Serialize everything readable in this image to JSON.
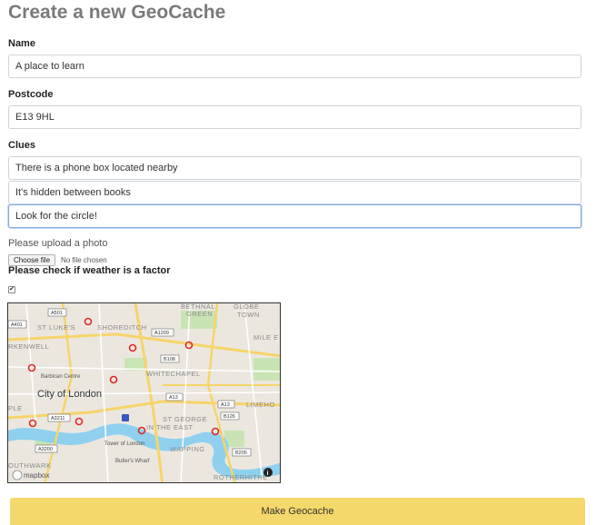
{
  "page": {
    "title": "Create a new GeoCache"
  },
  "form": {
    "name_label": "Name",
    "name_value": "A place to learn",
    "postcode_label": "Postcode",
    "postcode_value": "E13 9HL",
    "clues_label": "Clues",
    "clues": [
      "There is a phone box located nearby",
      "It's hidden between books",
      "Look for the circle!"
    ],
    "photo_label": "Please upload a photo",
    "file_button": "Choose file",
    "file_status": "No file chosen",
    "weather_label": "Please check if weather is a factor",
    "weather_checked": true,
    "submit_label": "Make Geocache"
  },
  "map": {
    "areas": [
      "BETHNAL",
      "GREEN",
      "GLOBE",
      "TOWN",
      "ST LUKE'S",
      "SHOREDITCH",
      "MILE E",
      "RKENWELL",
      "Barbican Centre",
      "WHITECHAPEL",
      "City of London",
      "LIMEHO",
      "PLE",
      "ST GEORGE",
      "IN THE EAST",
      "Tower of London",
      "WAPPING",
      "OUTHWARK",
      "Butler's Wharf",
      "ROTHERHITHE"
    ],
    "roads": [
      "A501",
      "A401",
      "A1209",
      "B108",
      "A13",
      "A3211",
      "B126",
      "A3200",
      "B205"
    ],
    "attribution": "mapbox",
    "info_icon": "i"
  }
}
